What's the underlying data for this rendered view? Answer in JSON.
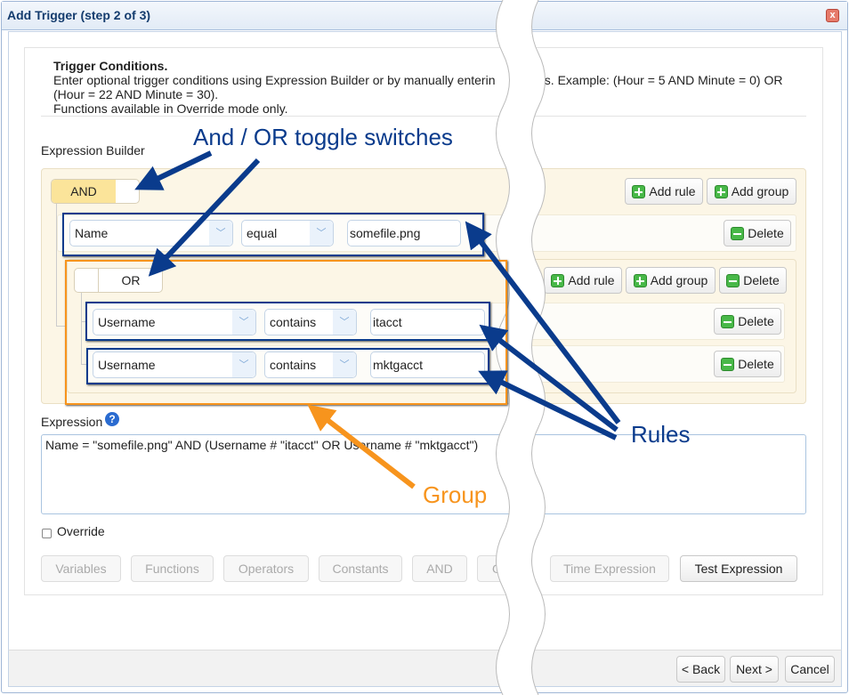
{
  "window": {
    "title": "Add Trigger (step 2 of 3)",
    "close_label": "x"
  },
  "header": {
    "title": "Trigger Conditions.",
    "line1a": "Enter optional trigger conditions using Expression Builder or by manually enterin",
    "line1b": "es. Example: (Hour = 5 AND Minute = 0) OR",
    "line2": "(Hour = 22 AND Minute = 30).",
    "line3": "Functions available in Override mode only."
  },
  "builder": {
    "label": "Expression Builder",
    "root": {
      "toggle": "AND",
      "add_rule": "Add rule",
      "add_group": "Add group",
      "rule": {
        "field": "Name",
        "operator": "equal",
        "value": "somefile.png",
        "delete": "Delete"
      },
      "group": {
        "toggle": "OR",
        "add_rule": "Add rule",
        "add_group": "Add group",
        "delete": "Delete",
        "rules": [
          {
            "field": "Username",
            "operator": "contains",
            "value": "itacct",
            "delete": "Delete"
          },
          {
            "field": "Username",
            "operator": "contains",
            "value": "mktgacct",
            "delete": "Delete"
          }
        ]
      }
    }
  },
  "expression": {
    "label": "Expression",
    "value": "Name = \"somefile.png\" AND (Username # \"itacct\" OR Username # \"mktgacct\")"
  },
  "override": {
    "label": "Override",
    "checked": false
  },
  "toolbar": {
    "variables": "Variables",
    "functions": "Functions",
    "operators": "Operators",
    "constants": "Constants",
    "and": "AND",
    "or": "O",
    "time": "Time Expression",
    "test": "Test Expression"
  },
  "footer": {
    "back": "< Back",
    "next": "Next >",
    "cancel": "Cancel"
  },
  "annotations": {
    "toggles": "And / OR toggle switches",
    "rules": "Rules",
    "group": "Group",
    "colors": {
      "rules": "#0a3b8c",
      "group": "#f7941d"
    }
  }
}
